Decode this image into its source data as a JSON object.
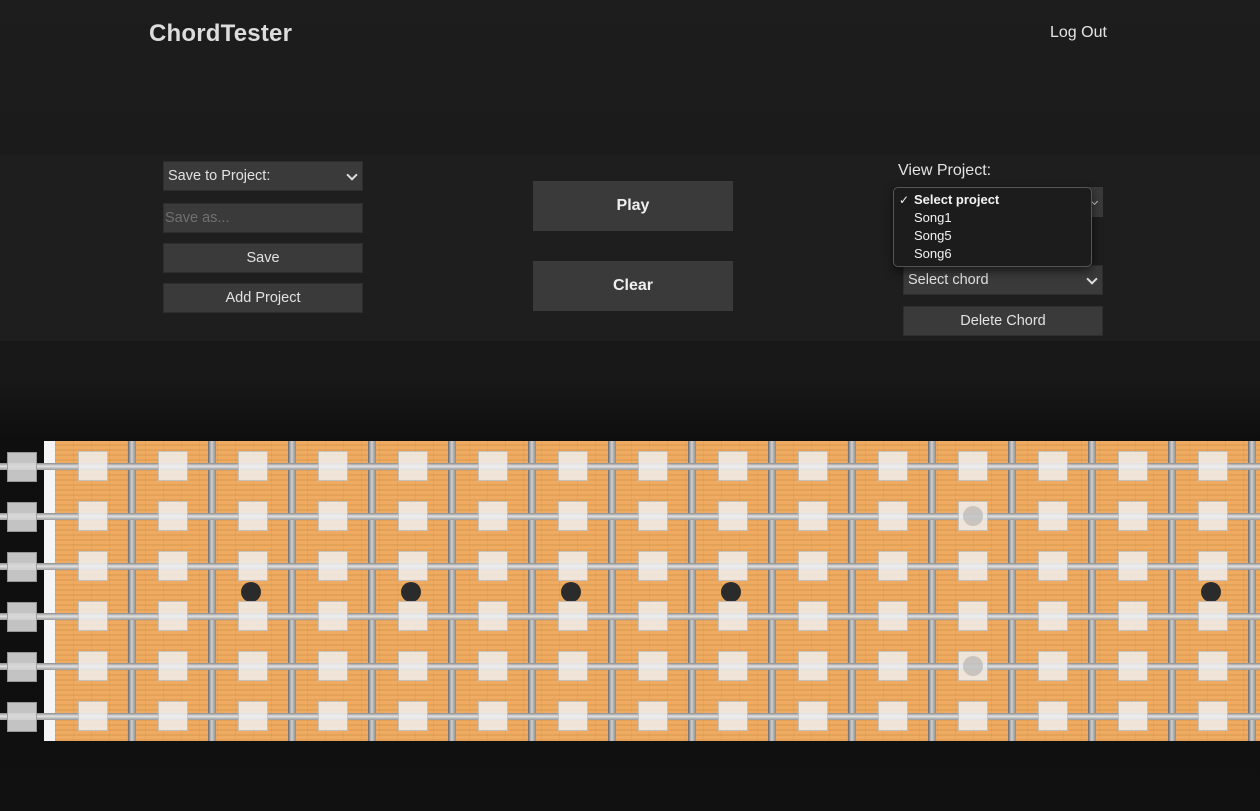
{
  "header": {
    "app_title": "ChordTester",
    "logout_label": "Log Out"
  },
  "left_panel": {
    "project_select_value": "Save to Project:",
    "save_as_placeholder": "Save as...",
    "save_label": "Save",
    "add_project_label": "Add Project"
  },
  "center_panel": {
    "play_label": "Play",
    "clear_label": "Clear"
  },
  "right_panel": {
    "view_project_label": "View Project:",
    "project_dropdown": {
      "selected": "Select project",
      "check_glyph": "✓",
      "options": [
        {
          "label": "Select project",
          "selected": true
        },
        {
          "label": "Song1",
          "selected": false
        },
        {
          "label": "Song5",
          "selected": false
        },
        {
          "label": "Song6",
          "selected": false
        }
      ]
    },
    "chord_select_value": "Select chord",
    "delete_chord_label": "Delete Chord"
  },
  "fretboard": {
    "string_count": 6,
    "fret_count": 15,
    "inlay_frets": [
      3,
      5,
      7,
      9,
      15
    ],
    "marked_notes": [
      {
        "string": 2,
        "fret": 12
      },
      {
        "string": 5,
        "fret": 12
      }
    ],
    "colors": {
      "wood": "#eea85c",
      "inlay": "#2b2b2b",
      "nut": "#f4f4f4"
    }
  }
}
